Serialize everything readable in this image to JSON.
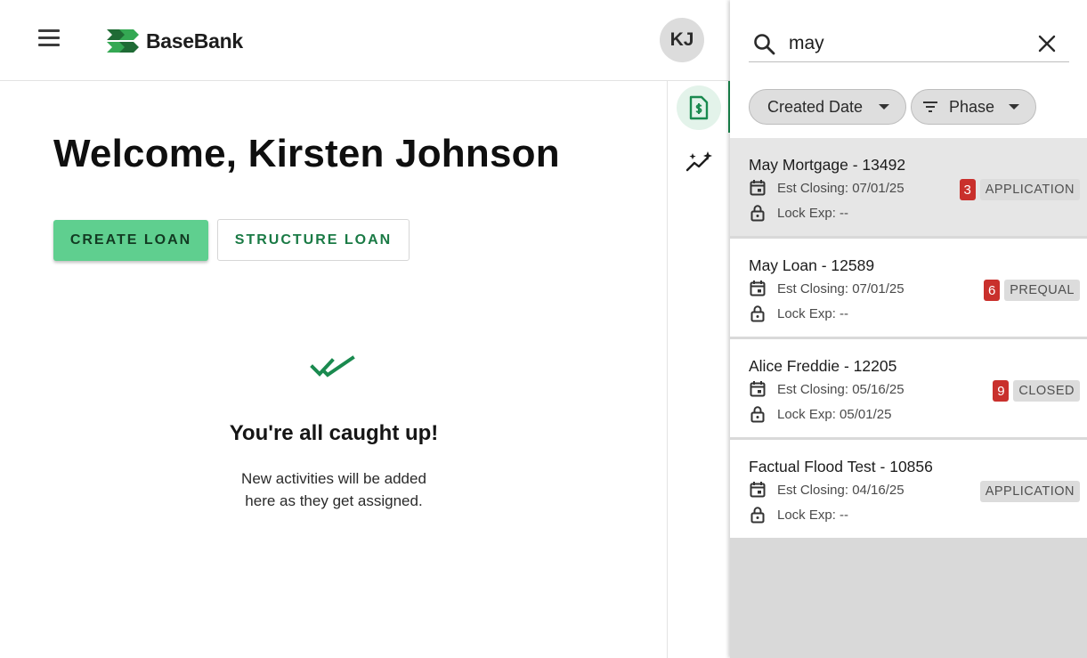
{
  "app": {
    "brand": "BaseBank",
    "user_initials": "KJ"
  },
  "main": {
    "welcome": "Welcome, Kirsten Johnson",
    "create_label": "CREATE LOAN",
    "structure_label": "STRUCTURE LOAN",
    "empty_title": "You're all caught up!",
    "empty_line1": "New activities will be added",
    "empty_line2": "here as they get assigned."
  },
  "rail": {
    "items": [
      "loan-document-icon",
      "sparkle-chart-icon"
    ]
  },
  "search": {
    "value": "may",
    "filters": {
      "date_label": "Created Date",
      "phase_label": "Phase"
    },
    "results": [
      {
        "title": "May Mortgage - 13492",
        "closing": "Est Closing: 07/01/25",
        "lock": "Lock Exp: --",
        "count": "3",
        "phase": "APPLICATION"
      },
      {
        "title": "May Loan - 12589",
        "closing": "Est Closing: 07/01/25",
        "lock": "Lock Exp: --",
        "count": "6",
        "phase": "PREQUAL"
      },
      {
        "title": "Alice Freddie - 12205",
        "closing": "Est Closing: 05/16/25",
        "lock": "Lock Exp: 05/01/25",
        "count": "9",
        "phase": "CLOSED"
      },
      {
        "title": "Factual Flood Test - 10856",
        "closing": "Est Closing: 04/16/25",
        "lock": "Lock Exp: --",
        "count": "",
        "phase": "APPLICATION"
      }
    ]
  },
  "colors": {
    "brand_green": "#1a8a4f",
    "primary_button": "#5fcf8f",
    "count_badge": "#c9302c"
  }
}
